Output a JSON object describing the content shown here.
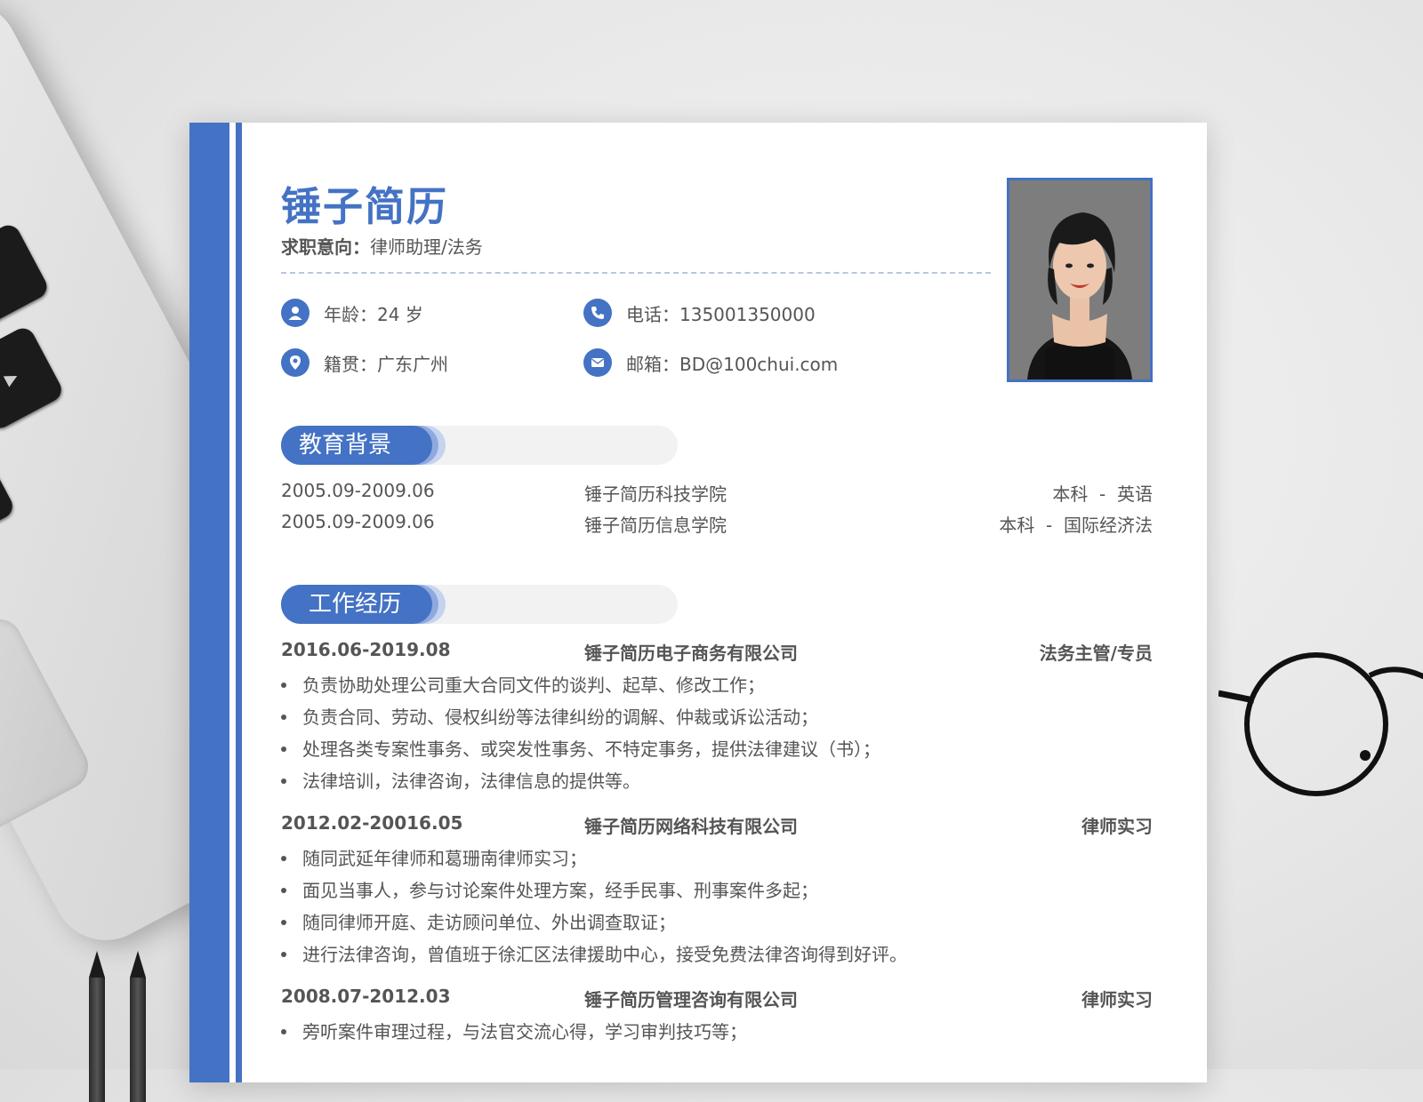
{
  "resume": {
    "name": "锤子简历",
    "intent_label": "求职意向：",
    "intent_value": "律师助理/法务",
    "info": {
      "age": "年龄：24 岁",
      "phone": "电话：135001350000",
      "hometown": "籍贯：广东广州",
      "email": "邮箱：BD@100chui.com"
    },
    "education": {
      "title": "教育背景",
      "rows": [
        {
          "date": "2005.09-2009.06",
          "school": "锤子简历科技学院",
          "degree": "本科  -  英语"
        },
        {
          "date": "2005.09-2009.06",
          "school": "锤子简历信息学院",
          "degree": "本科  -  国际经济法"
        }
      ]
    },
    "work": {
      "title": "工作经历",
      "jobs": [
        {
          "date": "2016.06-2019.08",
          "company": "锤子简历电子商务有限公司",
          "role": "法务主管/专员",
          "items": [
            "负责协助处理公司重大合同文件的谈判、起草、修改工作；",
            "负责合同、劳动、侵权纠纷等法律纠纷的调解、仲裁或诉讼活动；",
            "处理各类专案性事务、或突发性事务、不特定事务，提供法律建议（书）；",
            "法律培训，法律咨询，法律信息的提供等。"
          ]
        },
        {
          "date": "2012.02-20016.05",
          "company": "锤子简历网络科技有限公司",
          "role": "律师实习",
          "items": [
            "随同武延年律师和葛珊南律师实习；",
            "面见当事人，参与讨论案件处理方案，经手民事、刑事案件多起；",
            "随同律师开庭、走访顾问单位、外出调查取证；",
            "进行法律咨询，曾值班于徐汇区法律援助中心，接受免费法律咨询得到好评。"
          ]
        },
        {
          "date": "2008.07-2012.03",
          "company": "锤子简历管理咨询有限公司",
          "role": "律师实习",
          "items": [
            "旁听案件审理过程，与法官交流心得，学习审判技巧等；"
          ]
        }
      ]
    }
  },
  "colors": {
    "accent": "#4472c4",
    "text": "#555555"
  },
  "icons": [
    "user-icon",
    "phone-icon",
    "location-icon",
    "mail-icon"
  ]
}
